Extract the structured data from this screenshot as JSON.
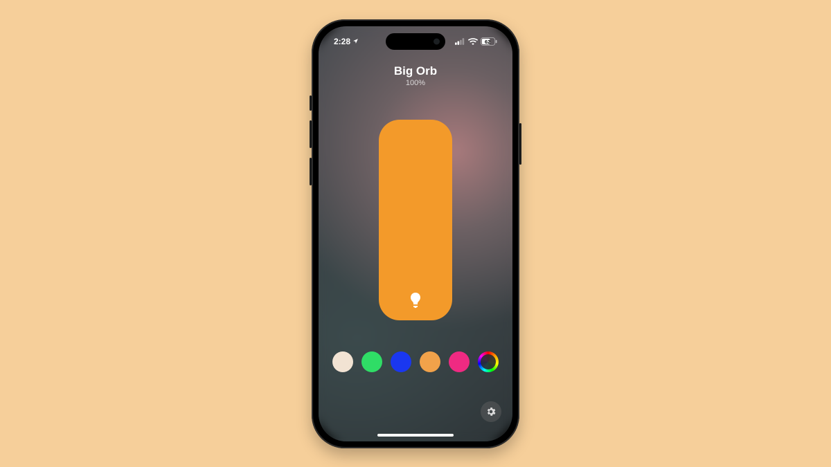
{
  "status": {
    "time": "2:28",
    "battery_text": "62"
  },
  "light": {
    "name": "Big Orb",
    "brightness_label": "100%",
    "brightness_value": 100,
    "slider_color": "#f39a2a"
  },
  "swatches": [
    {
      "name": "warm-white",
      "color": "#f2e3d3"
    },
    {
      "name": "green",
      "color": "#2fdd66"
    },
    {
      "name": "blue",
      "color": "#1a37f0"
    },
    {
      "name": "orange",
      "color": "#f1a24a"
    },
    {
      "name": "pink",
      "color": "#ef2a82"
    },
    {
      "name": "color-wheel",
      "color": "rainbow"
    }
  ]
}
